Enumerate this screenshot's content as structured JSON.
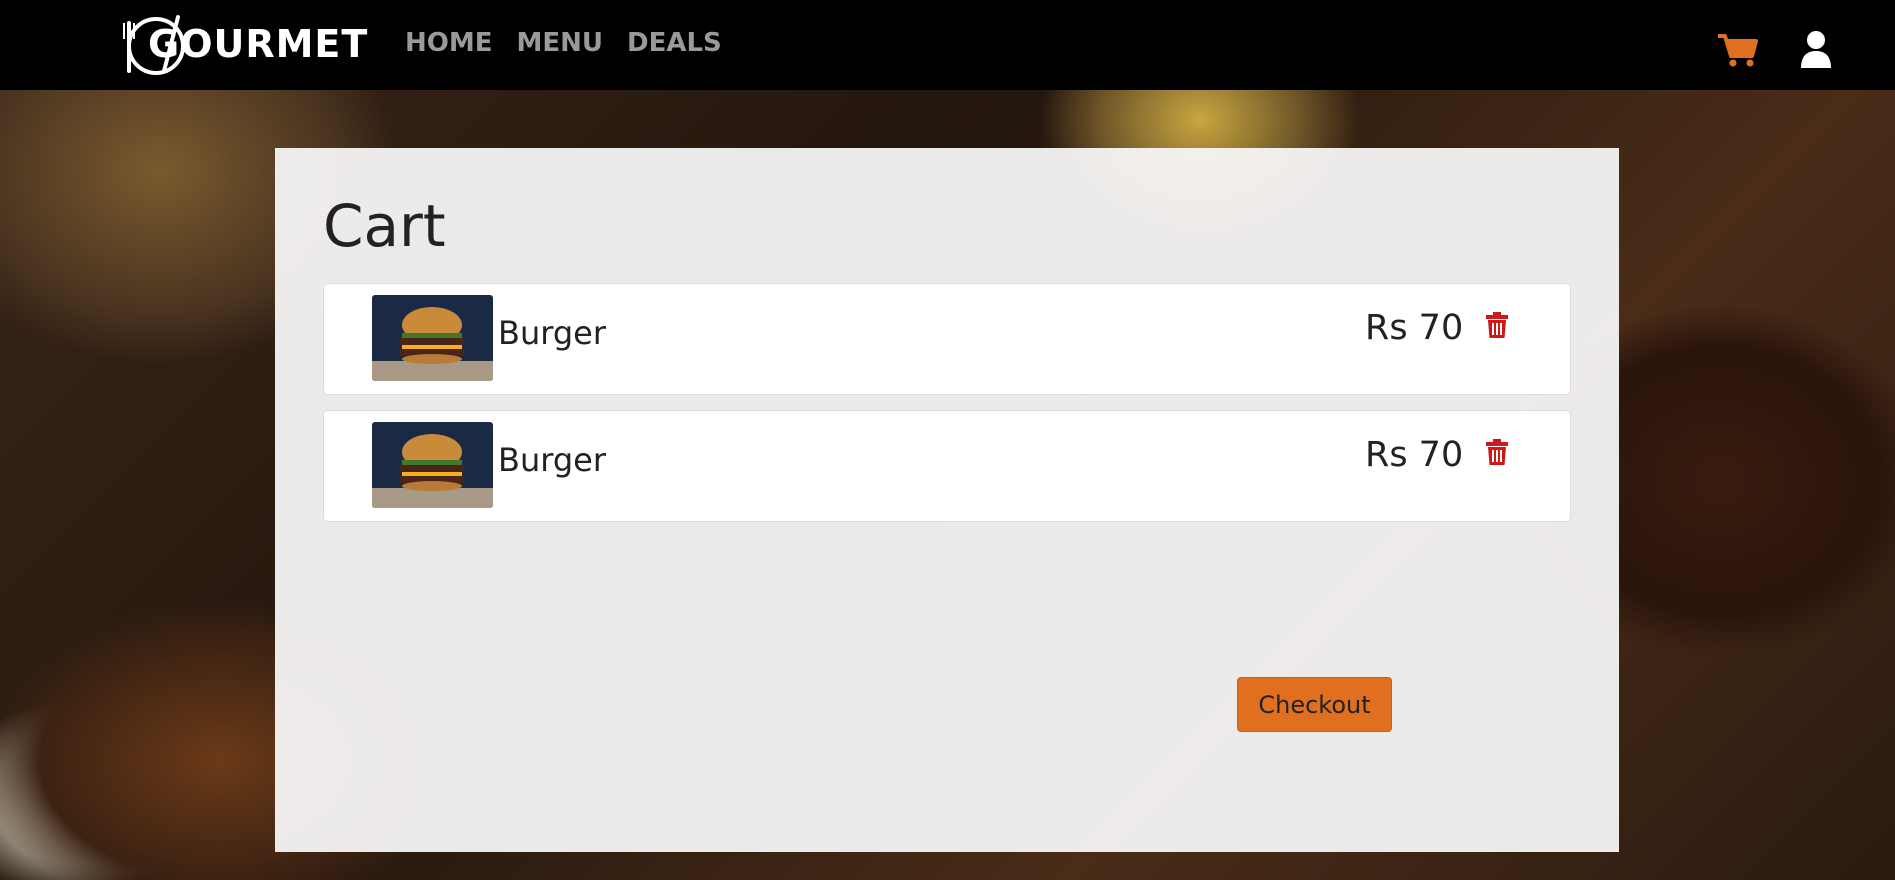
{
  "brand": {
    "name": "GOURMET"
  },
  "nav": {
    "links": [
      {
        "label": "HOME"
      },
      {
        "label": "MENU"
      },
      {
        "label": "DEALS"
      }
    ],
    "icons": [
      "cart-icon",
      "user-icon"
    ]
  },
  "cart": {
    "title": "Cart",
    "items": [
      {
        "name": "Burger",
        "price": "Rs 70"
      },
      {
        "name": "Burger",
        "price": "Rs 70"
      }
    ],
    "checkout_label": "Checkout"
  },
  "colors": {
    "accent": "#e07020",
    "nav_background": "#000000",
    "nav_link": "#9a9a9a",
    "delete": "#d01818"
  }
}
